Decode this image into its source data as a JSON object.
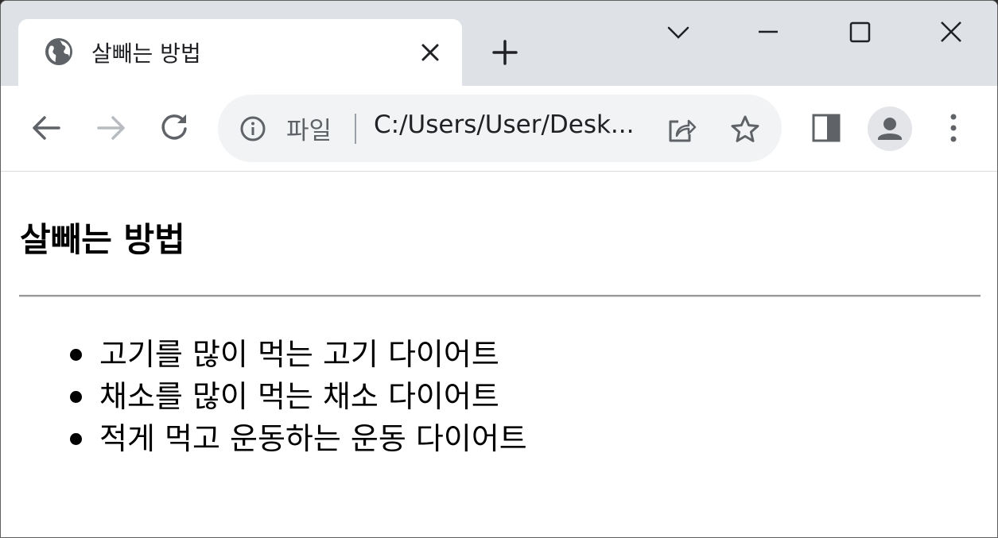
{
  "tab": {
    "title": "살빼는 방법",
    "icon": "globe-icon"
  },
  "address_bar": {
    "scheme_label": "파일",
    "url": "C:/Users/User/Desk..."
  },
  "page": {
    "heading": "살빼는 방법",
    "items": [
      "고기를 많이 먹는 고기 다이어트",
      "채소를 많이 먹는 채소 다이어트",
      "적게 먹고 운동하는 운동 다이어트"
    ]
  },
  "colors": {
    "tabstrip_bg": "#dee1e6",
    "omnibox_bg": "#f1f3f4",
    "icon_gray": "#5f6368"
  }
}
